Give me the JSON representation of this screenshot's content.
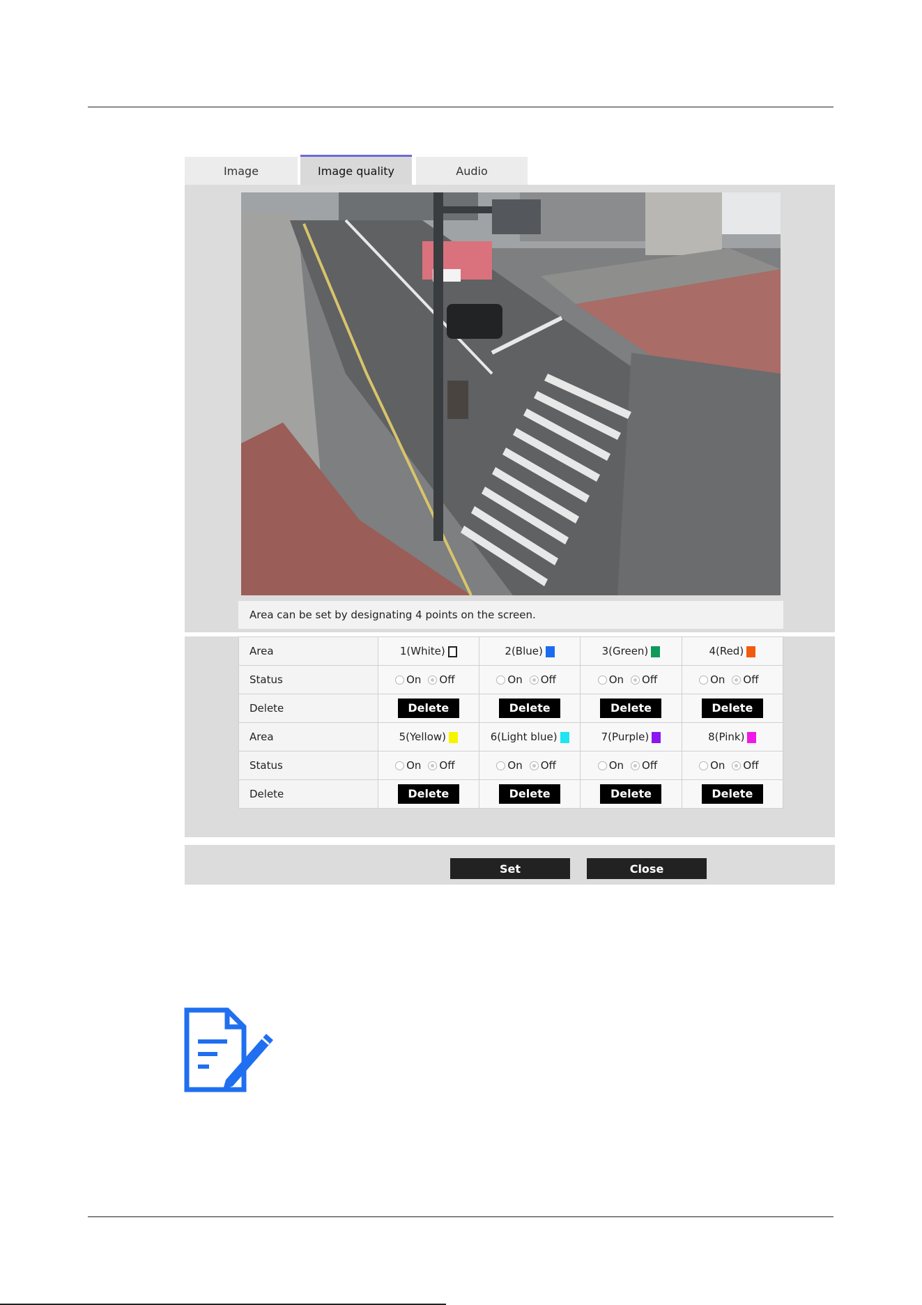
{
  "tabs": [
    {
      "label": "Image",
      "active": false
    },
    {
      "label": "Image quality",
      "active": true
    },
    {
      "label": "Audio",
      "active": false
    }
  ],
  "camera_view": {
    "icon": "camera-feed-image"
  },
  "note": "Area can be set by designating 4 points on the screen.",
  "table": {
    "area_label": "Area",
    "status_label": "Status",
    "delete_label": "Delete",
    "on_label": "On",
    "off_label": "Off",
    "delete_button": "Delete",
    "areas_row1": [
      {
        "label": "1(White)",
        "color": "#ffffff",
        "outline": true,
        "status": "Off"
      },
      {
        "label": "2(Blue)",
        "color": "#1a6cf0",
        "outline": false,
        "status": "Off"
      },
      {
        "label": "3(Green)",
        "color": "#0f9a5a",
        "outline": false,
        "status": "Off"
      },
      {
        "label": "4(Red)",
        "color": "#f25a0f",
        "outline": false,
        "status": "Off"
      }
    ],
    "areas_row2": [
      {
        "label": "5(Yellow)",
        "color": "#f5f500",
        "outline": false,
        "status": "Off"
      },
      {
        "label": "6(Light blue)",
        "color": "#20e5f0",
        "outline": false,
        "status": "Off"
      },
      {
        "label": "7(Purple)",
        "color": "#8a16f0",
        "outline": false,
        "status": "Off"
      },
      {
        "label": "8(Pink)",
        "color": "#f018e8",
        "outline": false,
        "status": "Off"
      }
    ]
  },
  "buttons": {
    "set": "Set",
    "close": "Close"
  },
  "memo_icon": {
    "icon": "memo-pen-icon",
    "color": "#1f6ff0"
  }
}
